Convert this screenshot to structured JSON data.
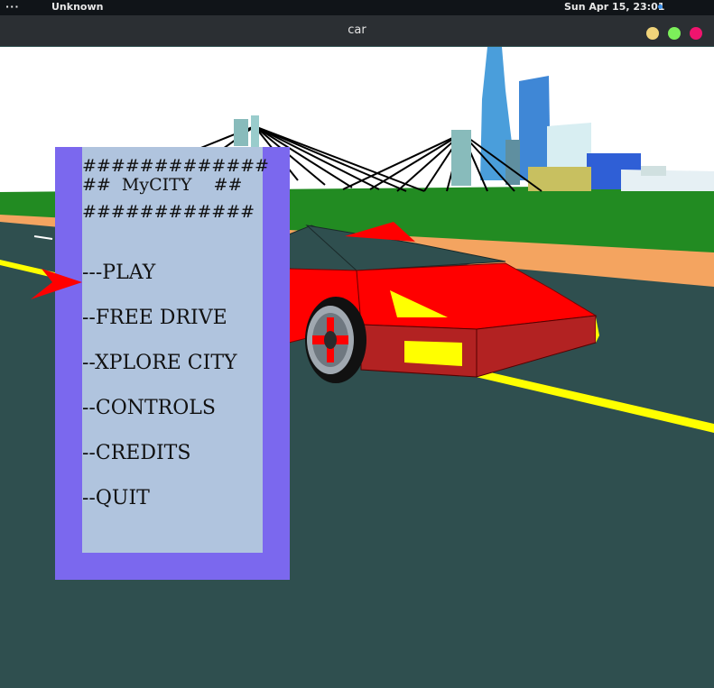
{
  "topbar": {
    "menu_dots": "···",
    "app_name": "Unknown",
    "clock": "Sun Apr 15, 23:01"
  },
  "window": {
    "title": "car"
  },
  "menu": {
    "header_lines": [
      "#############",
      "##  MyCITY    ##",
      "############"
    ],
    "items": [
      "---PLAY",
      "--FREE DRIVE",
      "--XPLORE CITY",
      "--CONTROLS",
      "--CREDITS",
      "--QUIT"
    ],
    "selected_index": 0
  },
  "colors": {
    "sky": "#ffffff",
    "grass": "#228b22",
    "road": "#2f4f4f",
    "sand": "#f4a460",
    "menu_border": "#7b68ee",
    "menu_panel": "#b0c4de",
    "car_body": "#ff0000",
    "car_dark": "#b22222",
    "accent_yellow": "#ffff00",
    "selector": "#ff0000"
  }
}
